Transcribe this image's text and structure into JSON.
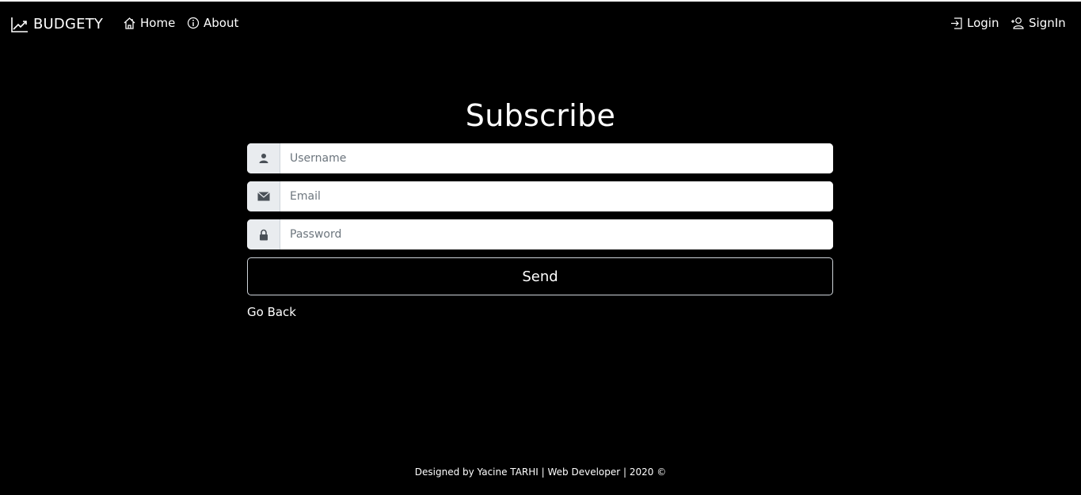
{
  "navbar": {
    "brand": "BUDGETY",
    "links_left": [
      {
        "label": "Home",
        "icon": "home-icon"
      },
      {
        "label": "About",
        "icon": "info-icon"
      }
    ],
    "links_right": [
      {
        "label": "Login",
        "icon": "login-icon"
      },
      {
        "label": "SignIn",
        "icon": "add-user-icon"
      }
    ]
  },
  "main": {
    "title": "Subscribe",
    "fields": {
      "username": {
        "placeholder": "Username",
        "value": "",
        "icon": "user-icon"
      },
      "email": {
        "placeholder": "Email",
        "value": "",
        "icon": "envelope-icon"
      },
      "password": {
        "placeholder": "Password",
        "value": "",
        "icon": "lock-icon"
      }
    },
    "submit_label": "Send",
    "back_link": "Go Back"
  },
  "footer": {
    "text": "Designed by Yacine TARHI | Web Developer | 2020 ©"
  },
  "colors": {
    "background": "#000000",
    "text": "#ffffff",
    "input_addon": "#e9ecef",
    "placeholder": "#6c757d"
  }
}
